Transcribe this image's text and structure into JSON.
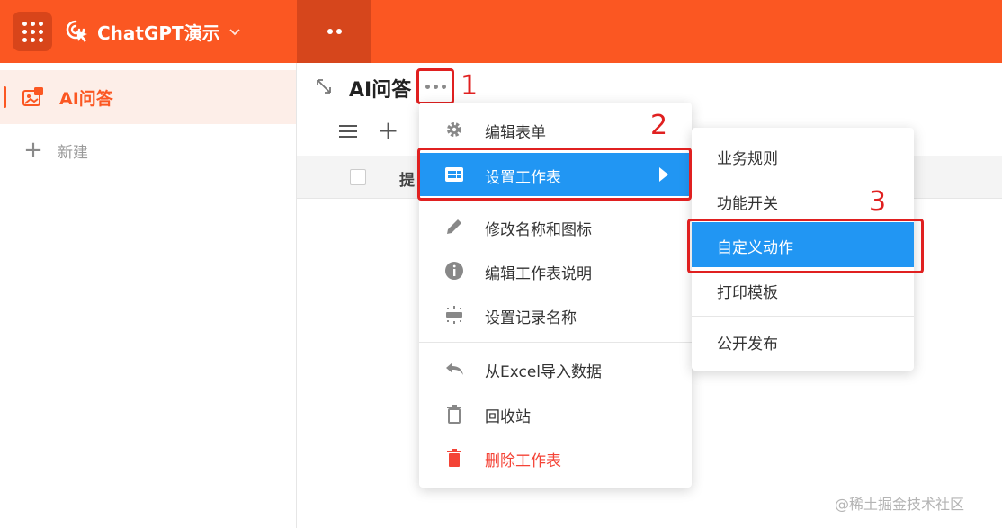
{
  "header": {
    "app_title": "ChatGPT演示",
    "brand_color": "#fb5722"
  },
  "sidebar": {
    "items": [
      {
        "label": "AI问答",
        "active": true
      }
    ],
    "new_label": "新建"
  },
  "main": {
    "page_title": "AI问答",
    "table": {
      "first_column_header": "提"
    }
  },
  "annotations": [
    "1",
    "2",
    "3"
  ],
  "menu": {
    "items": [
      {
        "label": "编辑表单",
        "icon": "gear-icon"
      },
      {
        "label": "设置工作表",
        "icon": "table-grid-icon",
        "active": true,
        "has_submenu": true
      },
      {
        "label": "修改名称和图标",
        "icon": "pencil-icon"
      },
      {
        "label": "编辑工作表说明",
        "icon": "info-icon"
      },
      {
        "label": "设置记录名称",
        "icon": "record-name-icon"
      },
      {
        "label": "从Excel导入数据",
        "icon": "reply-arrow-icon"
      },
      {
        "label": "回收站",
        "icon": "trash-outline-icon"
      },
      {
        "label": "删除工作表",
        "icon": "trash-filled-icon",
        "danger": true
      }
    ],
    "active_color": "#2196f3",
    "danger_color": "#f44336"
  },
  "submenu": {
    "items": [
      {
        "label": "业务规则"
      },
      {
        "label": "功能开关"
      },
      {
        "label": "自定义动作",
        "active": true
      },
      {
        "label": "打印模板"
      },
      {
        "label": "公开发布"
      }
    ]
  },
  "highlight_color": "#e02020",
  "watermark": "@稀土掘金技术社区"
}
